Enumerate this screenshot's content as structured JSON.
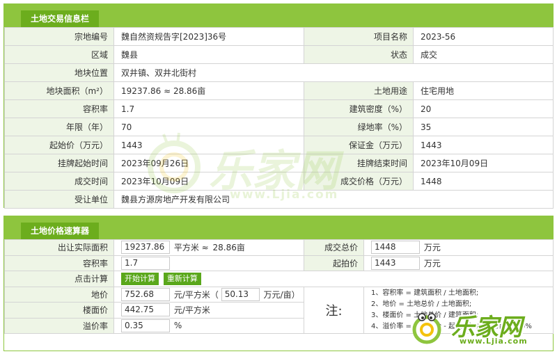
{
  "section1": {
    "title": "土地交易信息栏",
    "rows": [
      [
        {
          "label": "宗地编号",
          "value": "魏自然资规告字[2023]36号"
        },
        {
          "label": "项目名称",
          "value": "2023-56"
        }
      ],
      [
        {
          "label": "区域",
          "value": "魏县"
        },
        {
          "label": "状态",
          "value": "成交"
        }
      ],
      [
        {
          "label": "地块位置",
          "value": "双井镇、双井北街村"
        }
      ],
      [
        {
          "label": "地块面积（m²）",
          "value": "19237.86 ≈ 28.86亩"
        },
        {
          "label": "土地用途",
          "value": "住宅用地"
        }
      ],
      [
        {
          "label": "容积率",
          "value": "1.7"
        },
        {
          "label": "建筑密度（%）",
          "value": "20"
        }
      ],
      [
        {
          "label": "年限（年）",
          "value": "70"
        },
        {
          "label": "绿地率（%）",
          "value": "35"
        }
      ],
      [
        {
          "label": "起始价（万元）",
          "value": "1443"
        },
        {
          "label": "保证金（万元）",
          "value": "1443"
        }
      ],
      [
        {
          "label": "挂牌起始时间",
          "value": "2023年09月26日"
        },
        {
          "label": "挂牌结束时间",
          "value": "2023年10月09日"
        }
      ],
      [
        {
          "label": "成交时间",
          "value": "2023年10月09日"
        },
        {
          "label": "成交价格（万元）",
          "value": "1448"
        }
      ],
      [
        {
          "label": "受让单位",
          "value": "魏县方源房地产开发有限公司"
        }
      ]
    ]
  },
  "section2": {
    "title": "土地价格速算器",
    "area": {
      "label": "出让实际面积",
      "value": "19237.86",
      "unit": "平方米 ≈",
      "mu": "28.86亩"
    },
    "total": {
      "label": "成交总价",
      "value": "1448",
      "unit": "万元"
    },
    "far": {
      "label": "容积率",
      "value": "1.7"
    },
    "start": {
      "label": "起拍价",
      "value": "1443",
      "unit": "万元"
    },
    "calc": {
      "label": "点击计算",
      "start_btn": "开始计算",
      "reset_btn": "重新计算"
    },
    "land_price": {
      "label": "地价",
      "value": "752.68",
      "unit": "元/平方米（",
      "value2": "50.13",
      "unit2": "万元/亩）"
    },
    "floor_price": {
      "label": "楼面价",
      "value": "442.75",
      "unit": "元/平方米"
    },
    "premium": {
      "label": "溢价率",
      "value": "0.35",
      "unit": "%"
    },
    "note_label": "注:",
    "notes": [
      "1、容积率 = 建筑面积 / 土地面积;",
      "2、地价 = 土地总价 / 土地面积;",
      "3、楼面价 = 土地总价 / 建筑面积;",
      "4、溢价率 = （成交价 - 起拍价）/ 起拍价 × 100%"
    ]
  },
  "watermark": {
    "text": "乐家网",
    "url": "www.Ljia.com"
  },
  "colors": {
    "bar": "#8ec53e",
    "tab": "#6cad1d",
    "label_bg": "#eef5e6",
    "border": "#d4d4d4",
    "button": "#5aa71b"
  }
}
